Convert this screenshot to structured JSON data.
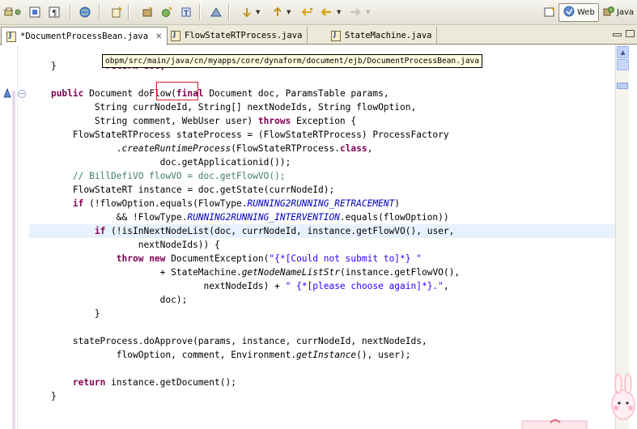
{
  "perspectives": {
    "web_label": "Web",
    "java_label": "Java"
  },
  "tabs": [
    {
      "label": "*DocumentProcessBean.java",
      "active": true
    },
    {
      "label": "FlowStateRTProcess.java",
      "active": false
    },
    {
      "label": "StateMachine.java",
      "active": false
    }
  ],
  "tooltip": "obpm/src/main/java/cn/myapps/core/dynaform/document/ejb/DocumentProcessBean.java",
  "code": {
    "l0": "        return doc;",
    "l1": "    }",
    "l3a": "public",
    "l3b": " Document ",
    "l3c": "doFlow(",
    "l3d": "final",
    "l3e": " Document doc, ParamsTable params,",
    "l4": "            String currNodeId, String[] nextNodeIds, String flowOption,",
    "l5a": "            String comment, WebUser user) ",
    "l5b": "throws",
    "l5c": " Exception {",
    "l6": "        FlowStateRTProcess stateProcess = (FlowStateRTProcess) ProcessFactory",
    "l7a": "                .",
    "l7b": "createRuntimeProcess",
    "l7c": "(FlowStateRTProcess.",
    "l7d": "class",
    "l7e": ",",
    "l8": "                        doc.getApplicationid());",
    "l9": "        // BillDefiVO flowVO = doc.getFlowVO();",
    "l10": "        FlowStateRT instance = doc.getState(currNodeId);",
    "l11a": "        ",
    "l11b": "if",
    "l11c": " (!flowOption.equals(FlowType.",
    "l11d": "RUNNING2RUNNING_RETRACEMENT",
    "l11e": ")",
    "l12a": "                && !FlowType.",
    "l12b": "RUNNING2RUNNING_INTERVENTION",
    "l12c": ".equals(flowOption))",
    "l13a": "            ",
    "l13b": "if",
    "l13c": " (!isInNextNodeList(doc, currNodeId, instance.getFlowVO(), user,",
    "l14": "                    nextNodeIds)) {",
    "l15a": "                ",
    "l15b": "throw new",
    "l15c": " DocumentException(",
    "l15d": "\"{*[Could not submit to]*} \"",
    "l16a": "                        + StateMachine.",
    "l16b": "getNodeNameListStr",
    "l16c": "(instance.getFlowVO(),",
    "l17a": "                                nextNodeIds) + ",
    "l17b": "\" {*[please choose again]*}.\"",
    "l17c": ",",
    "l18": "                        doc);",
    "l19": "            }",
    "l21": "        stateProcess.doApprove(params, instance, currNodeId, nextNodeIds,",
    "l22a": "                flowOption, comment, Environment.",
    "l22b": "getInstance",
    "l22c": "(), user);",
    "l24a": "        ",
    "l24b": "return",
    "l24c": " instance.getDocument();",
    "l25": "    }"
  },
  "colors": {
    "keyword": "#7f0055",
    "comment": "#3f7f5f",
    "string": "#2a00ff",
    "current_line": "#e8f2fe",
    "selection_box": "#d62020"
  }
}
